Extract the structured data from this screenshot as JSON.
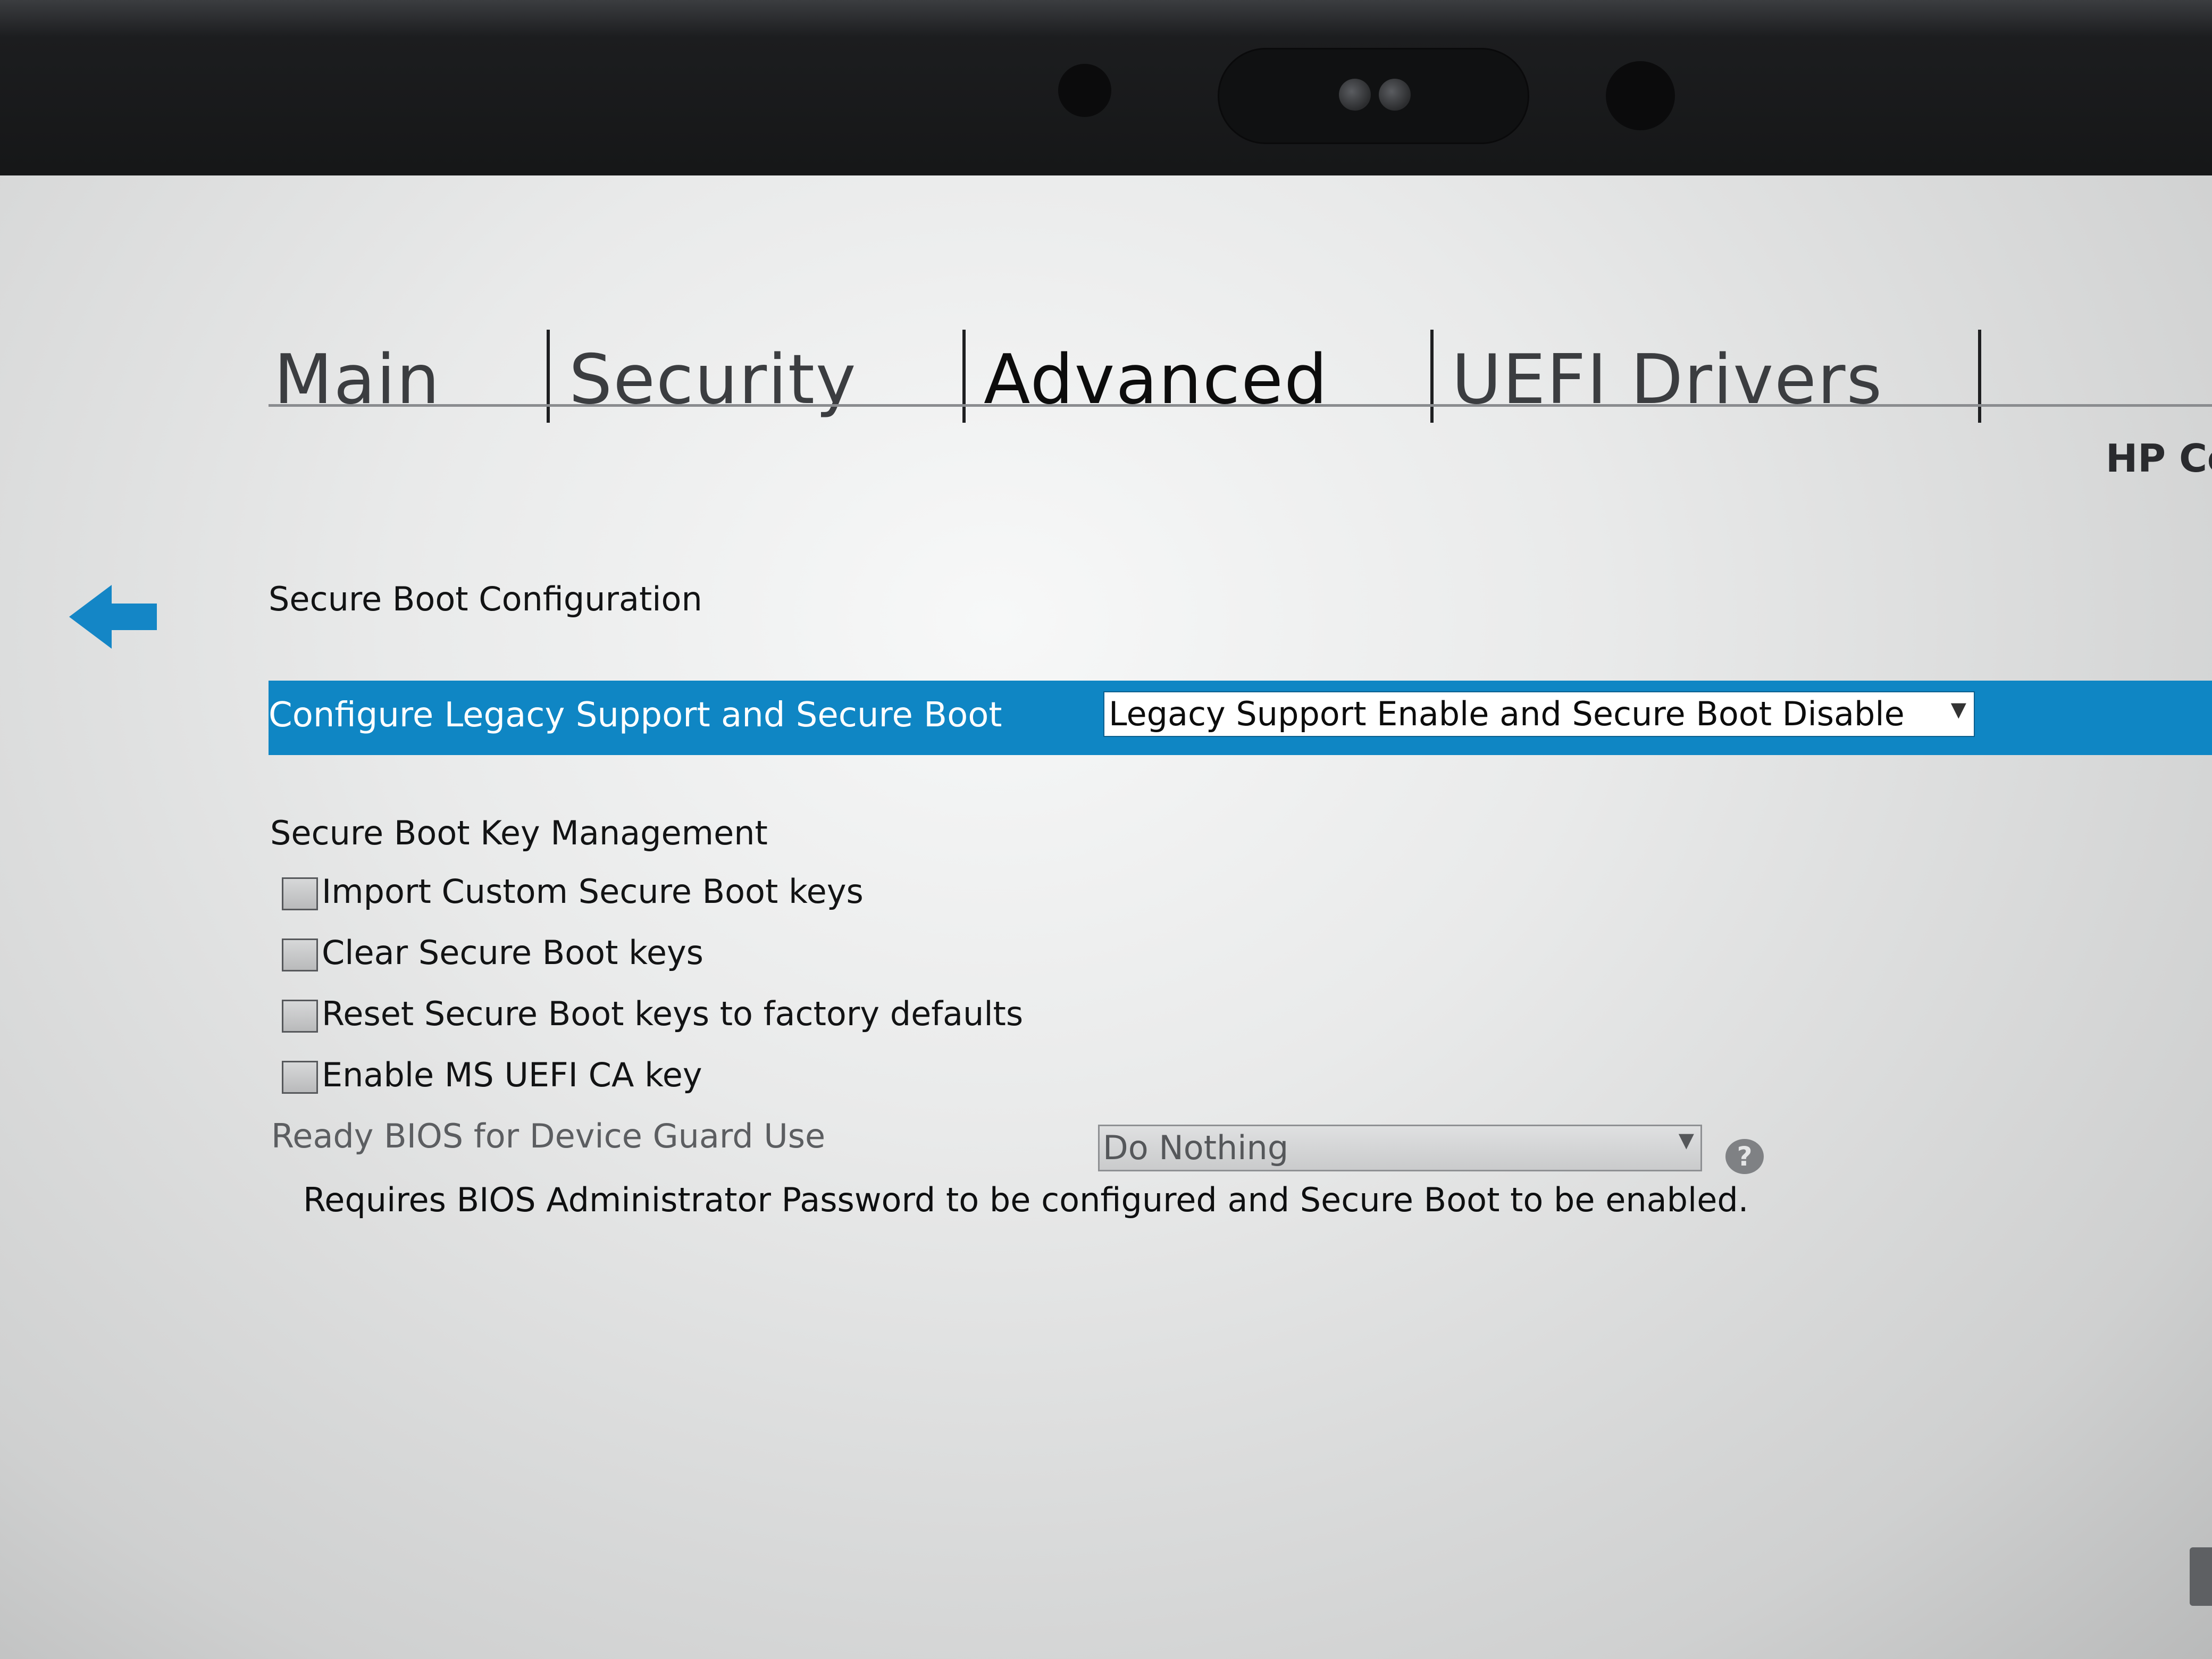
{
  "tabs": {
    "main": "Main",
    "security": "Security",
    "advanced": "Advanced",
    "uefi_drivers": "UEFI Drivers",
    "active": "Advanced"
  },
  "brand_text": "HP Co",
  "page": {
    "title": "Secure Boot Configuration"
  },
  "legacy_row": {
    "label": "Configure Legacy Support and Secure Boot",
    "value": "Legacy Support Enable and Secure Boot Disable"
  },
  "key_management": {
    "heading": "Secure Boot Key Management",
    "items": [
      {
        "label": "Import Custom Secure Boot keys",
        "checked": false
      },
      {
        "label": "Clear Secure Boot keys",
        "checked": false
      },
      {
        "label": "Reset Secure Boot keys to factory defaults",
        "checked": false
      },
      {
        "label": "Enable MS UEFI CA key",
        "checked": false
      }
    ]
  },
  "device_guard": {
    "label": "Ready BIOS for Device Guard Use",
    "value": "Do Nothing",
    "help_symbol": "?",
    "note": "Requires BIOS Administrator Password to be configured and Secure Boot to be enabled."
  },
  "colors": {
    "highlight": "#0f86c4",
    "arrow": "#1486c6"
  },
  "icons": {
    "back": "back-arrow-icon",
    "help": "help-icon",
    "dropdown": "chevron-down-icon"
  }
}
